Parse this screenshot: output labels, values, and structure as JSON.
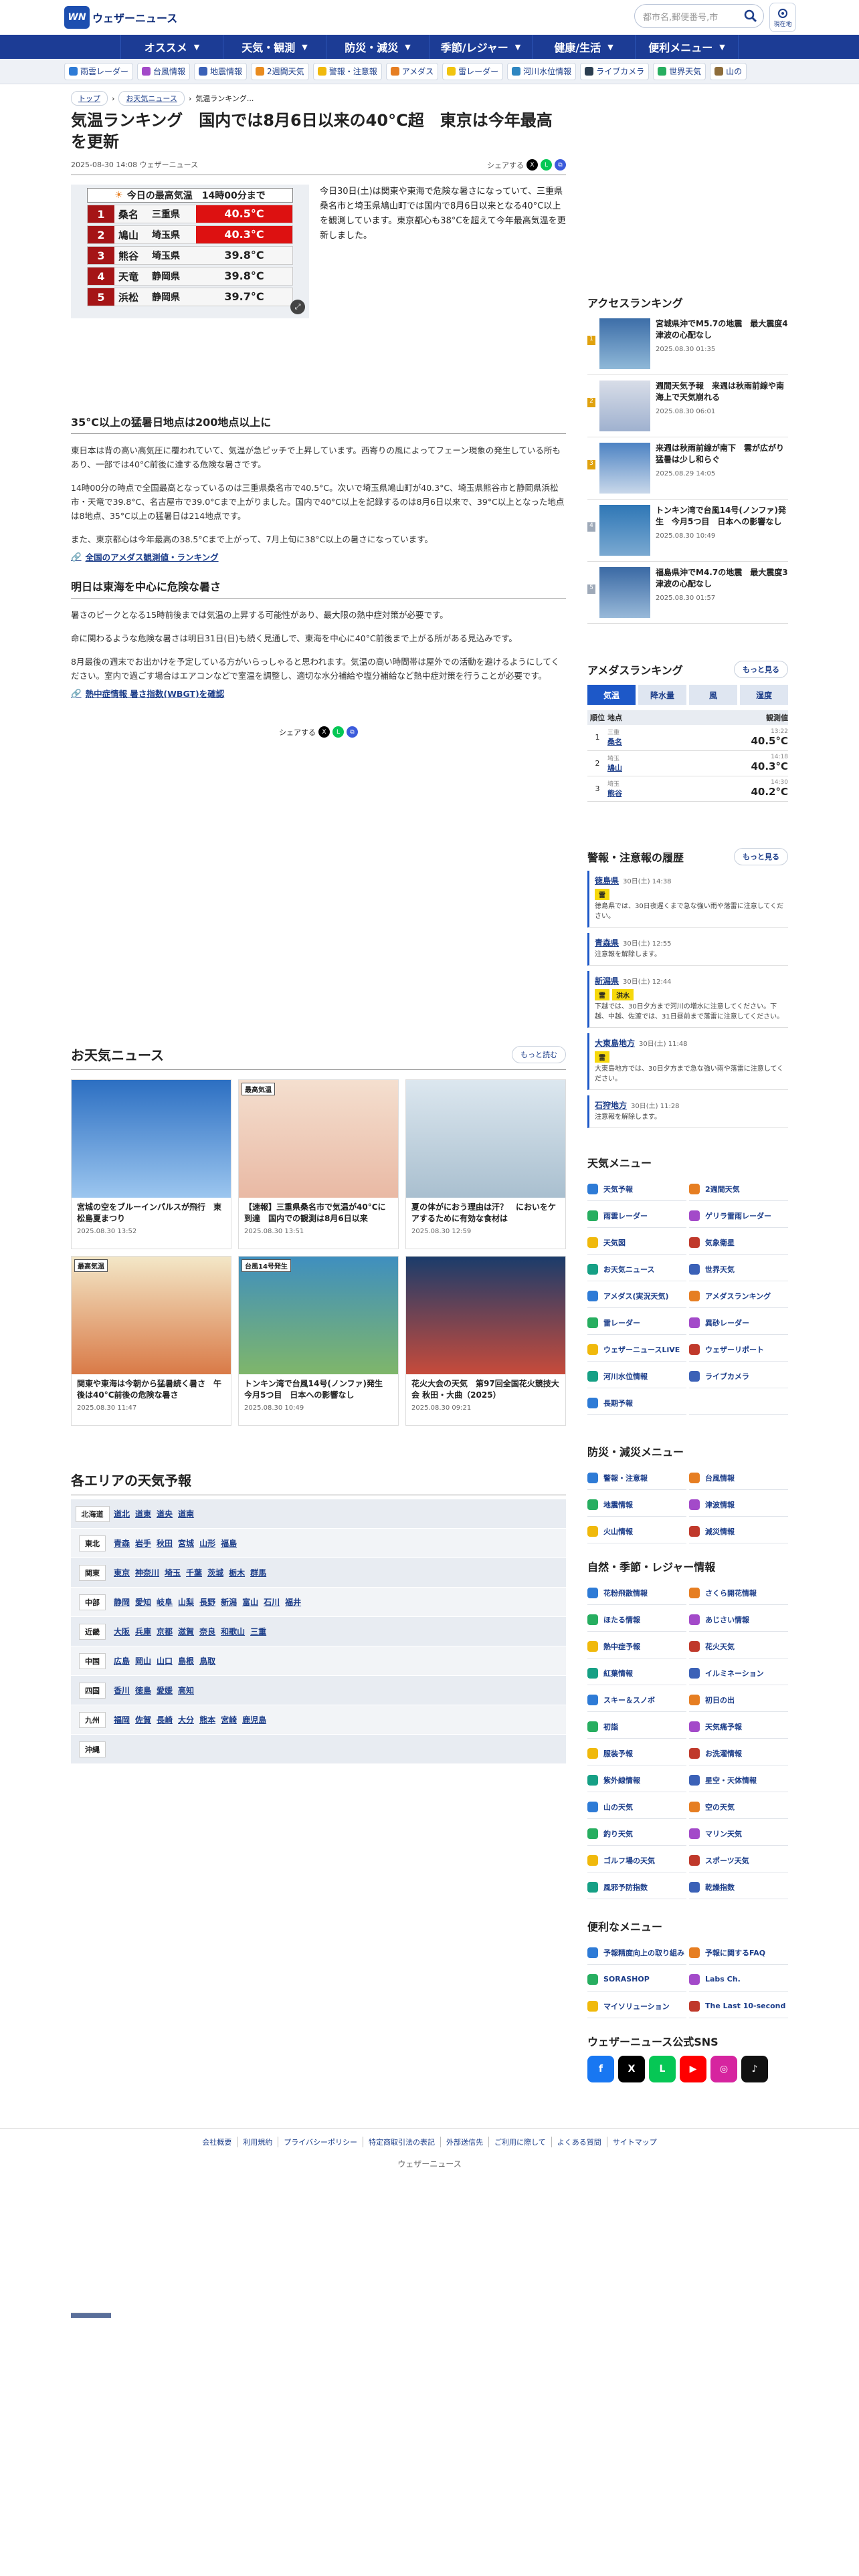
{
  "brand": "ウェザーニュース",
  "search": {
    "placeholder": "都市名,郵便番号,市"
  },
  "location_label": "現在地",
  "nav": [
    "オススメ",
    "天気・観測",
    "防災・減災",
    "季節/レジャー",
    "健康/生活",
    "便利メニュー"
  ],
  "subnav": [
    "雨雲レーダー",
    "台風情報",
    "地震情報",
    "2週間天気",
    "警報・注意報",
    "アメダス",
    "雷レーダー",
    "河川水位情報",
    "ライブカメラ",
    "世界天気",
    "山の"
  ],
  "breadcrumb": [
    "トップ",
    "お天気ニュース",
    "気温ランキング..."
  ],
  "article": {
    "title": "気温ランキング　国内では8月6日以来の40°C超　東京は今年最高を更新",
    "meta": "2025-08-30 14:08 ウェザーニュース",
    "share_label": "シェアする",
    "lead": "今日30日(土)は関東や東海で危険な暑さになっていて、三重県桑名市と埼玉県鳩山町では国内で8月6日以来となる40°C以上を観測しています。東京都心も38°Cを超えて今年最高気温を更新しました。",
    "ranking": {
      "title": "今日の最高気温　14時00分まで",
      "rows": [
        {
          "rank": "1",
          "city": "桑名",
          "pref": "三重県",
          "temp": "40.5°C",
          "hot": true
        },
        {
          "rank": "2",
          "city": "鳩山",
          "pref": "埼玉県",
          "temp": "40.3°C",
          "hot": true
        },
        {
          "rank": "3",
          "city": "熊谷",
          "pref": "埼玉県",
          "temp": "39.8°C",
          "hot": false
        },
        {
          "rank": "4",
          "city": "天竜",
          "pref": "静岡県",
          "temp": "39.8°C",
          "hot": false
        },
        {
          "rank": "5",
          "city": "浜松",
          "pref": "静岡県",
          "temp": "39.7°C",
          "hot": false
        }
      ]
    },
    "h2a": "35°C以上の猛暑日地点は200地点以上に",
    "p1": "東日本は背の高い高気圧に覆われていて、気温が急ピッチで上昇しています。西寄りの風によってフェーン現象の発生している所もあり、一部では40°C前後に達する危険な暑さです。",
    "p2": "14時00分の時点で全国最高となっているのは三重県桑名市で40.5°C。次いで埼玉県鳩山町が40.3°C、埼玉県熊谷市と静岡県浜松市・天竜で39.8°C、名古屋市で39.0°Cまで上がりました。国内で40°C以上を記録するのは8月6日以来で、39°C以上となった地点は8地点、35°C以上の猛暑日は214地点です。",
    "p3": "また、東京都心は今年最高の38.5°Cまで上がって、7月上旬に38°C以上の暑さになっています。",
    "link1": "全国のアメダス観測値・ランキング",
    "h2b": "明日は東海を中心に危険な暑さ",
    "p4": "暑さのピークとなる15時前後までは気温の上昇する可能性があり、最大限の熱中症対策が必要です。",
    "p5": "命に関わるような危険な暑さは明日31日(日)も続く見通しで、東海を中心に40°C前後まで上がる所がある見込みです。",
    "p6": "8月最後の週末でお出かけを予定している方がいらっしゃると思われます。気温の高い時間帯は屋外での活動を避けるようにしてください。室内で過ごす場合はエアコンなどで室温を調整し、適切な水分補給や塩分補給など熱中症対策を行うことが必要です。",
    "link2": "熱中症情報 暑さ指数(WBGT)を確認"
  },
  "news": {
    "title": "お天気ニュース",
    "more": "もっと読む",
    "items": [
      {
        "title": "宮城の空をブルーインパルスが飛行　東松島夏まつり",
        "date": "2025.08.30 13:52",
        "tag": ""
      },
      {
        "title": "【速報】三重県桑名市で気温が40°Cに到達　国内での観測は8月6日以来",
        "date": "2025.08.30 13:51",
        "tag": "最高気温"
      },
      {
        "title": "夏の体がにおう理由は汗？　においをケアするために有効な食材は",
        "date": "2025.08.30 12:59",
        "tag": ""
      },
      {
        "title": "関東や東海は今朝から猛暑続く暑さ　午後は40°C前後の危険な暑さ",
        "date": "2025.08.30 11:47",
        "tag": "最高気温"
      },
      {
        "title": "トンキン湾で台風14号(ノンファ)発生　今月5つ目　日本への影響なし",
        "date": "2025.08.30 10:49",
        "tag": "台風14号発生"
      },
      {
        "title": "花火大会の天気　第97回全国花火競技大会 秋田・大曲（2025）",
        "date": "2025.08.30 09:21",
        "tag": ""
      }
    ]
  },
  "areas": {
    "title": "各エリアの天気予報",
    "rows": [
      {
        "region": "北海道",
        "prefs": [
          "道北",
          "道東",
          "道央",
          "道南"
        ]
      },
      {
        "region": "東北",
        "prefs": [
          "青森",
          "岩手",
          "秋田",
          "宮城",
          "山形",
          "福島"
        ]
      },
      {
        "region": "関東",
        "prefs": [
          "東京",
          "神奈川",
          "埼玉",
          "千葉",
          "茨城",
          "栃木",
          "群馬"
        ]
      },
      {
        "region": "中部",
        "prefs": [
          "静岡",
          "愛知",
          "岐阜",
          "山梨",
          "長野",
          "新潟",
          "富山",
          "石川",
          "福井"
        ]
      },
      {
        "region": "近畿",
        "prefs": [
          "大阪",
          "兵庫",
          "京都",
          "滋賀",
          "奈良",
          "和歌山",
          "三重"
        ]
      },
      {
        "region": "中国",
        "prefs": [
          "広島",
          "岡山",
          "山口",
          "島根",
          "鳥取"
        ]
      },
      {
        "region": "四国",
        "prefs": [
          "香川",
          "徳島",
          "愛媛",
          "高知"
        ]
      },
      {
        "region": "九州",
        "prefs": [
          "福岡",
          "佐賀",
          "長崎",
          "大分",
          "熊本",
          "宮崎",
          "鹿児島"
        ]
      },
      {
        "region": "沖縄",
        "prefs": []
      }
    ]
  },
  "access": {
    "title": "アクセスランキング",
    "items": [
      {
        "rank": "1",
        "title": "宮城県沖でM5.7の地震　最大震度4　津波の心配なし",
        "date": "2025.08.30 01:35"
      },
      {
        "rank": "2",
        "title": "週間天気予報　来週は秋雨前線や南海上で天気崩れる",
        "date": "2025.08.30 06:01"
      },
      {
        "rank": "3",
        "title": "来週は秋雨前線が南下　雲が広がり猛暑は少し和らぐ",
        "date": "2025.08.29 14:05"
      },
      {
        "rank": "4",
        "title": "トンキン湾で台風14号(ノンファ)発生　今月5つ目　日本への影響なし",
        "date": "2025.08.30 10:49"
      },
      {
        "rank": "5",
        "title": "福島県沖でM4.7の地震　最大震度3　津波の心配なし",
        "date": "2025.08.30 01:57"
      }
    ]
  },
  "amedas": {
    "title": "アメダスランキング",
    "more": "もっと見る",
    "tabs": [
      "気温",
      "降水量",
      "風",
      "湿度"
    ],
    "head": [
      "順位",
      "地点",
      "観測値"
    ],
    "rows": [
      {
        "rank": "1",
        "pref": "三重",
        "place": "桑名",
        "time": "13:22",
        "val": "40.5°C"
      },
      {
        "rank": "2",
        "pref": "埼玉",
        "place": "鳩山",
        "time": "14:18",
        "val": "40.3°C"
      },
      {
        "rank": "3",
        "pref": "埼玉",
        "place": "熊谷",
        "time": "14:30",
        "val": "40.2°C"
      }
    ]
  },
  "warn": {
    "title": "警報・注意報の履歴",
    "more": "もっと見る",
    "items": [
      {
        "place": "徳島県",
        "time": "30日(土) 14:38",
        "badges": [
          "雷"
        ],
        "text": "徳島県では、30日夜遅くまで急な強い雨や落雷に注意してください。"
      },
      {
        "place": "青森県",
        "time": "30日(土) 12:55",
        "badges": [],
        "text": "注意報を解除します。"
      },
      {
        "place": "新潟県",
        "time": "30日(土) 12:44",
        "badges": [
          "雷",
          "洪水"
        ],
        "text": "下越では、30日夕方まで河川の増水に注意してください。下越、中越、佐渡では、31日昼前まで落雷に注意してください。"
      },
      {
        "place": "大東島地方",
        "time": "30日(土) 11:48",
        "badges": [
          "雷"
        ],
        "text": "大東島地方では、30日夕方まで急な強い雨や落雷に注意してください。"
      },
      {
        "place": "石狩地方",
        "time": "30日(土) 11:28",
        "badges": [],
        "text": "注意報を解除します。"
      }
    ]
  },
  "menu1": {
    "title": "天気メニュー",
    "items": [
      "天気予報",
      "2週間天気",
      "雨雲レーダー",
      "ゲリラ雷雨レーダー",
      "天気図",
      "気象衛星",
      "お天気ニュース",
      "世界天気",
      "アメダス(実況天気)",
      "アメダスランキング",
      "雷レーダー",
      "異砂レーダー",
      "ウェザーニュースLiVE",
      "ウェザーリポート",
      "河川水位情報",
      "ライブカメラ",
      "長期予報",
      ""
    ]
  },
  "menu2": {
    "title": "防災・減災メニュー",
    "items": [
      "警報・注意報",
      "台風情報",
      "地震情報",
      "津波情報",
      "火山情報",
      "減災情報"
    ]
  },
  "menu3": {
    "title": "自然・季節・レジャー情報",
    "items": [
      "花粉飛散情報",
      "さくら開花情報",
      "ほたる情報",
      "あじさい情報",
      "熱中症予報",
      "花火天気",
      "紅葉情報",
      "イルミネーション",
      "スキー＆スノボ",
      "初日の出",
      "初詣",
      "天気痛予報",
      "服装予報",
      "お洗濯情報",
      "紫外線情報",
      "星空・天体情報",
      "山の天気",
      "空の天気",
      "釣り天気",
      "マリン天気",
      "ゴルフ場の天気",
      "スポーツ天気",
      "風邪予防指数",
      "乾燥指数"
    ]
  },
  "menu4": {
    "title": "便利なメニュー",
    "items": [
      "予報精度向上の取り組み",
      "予報に関するFAQ",
      "SORASHOP",
      "Labs Ch.",
      "マイソリューション",
      "The Last 10-second"
    ]
  },
  "sns": {
    "title": "ウェザーニュース公式SNS"
  },
  "footer": {
    "links": [
      "会社概要",
      "利用規約",
      "プライバシーポリシー",
      "特定商取引法の表記",
      "外部送信先",
      "ご利用に際して",
      "よくある質問",
      "サイトマップ"
    ],
    "copy": "ウェザーニュース"
  }
}
